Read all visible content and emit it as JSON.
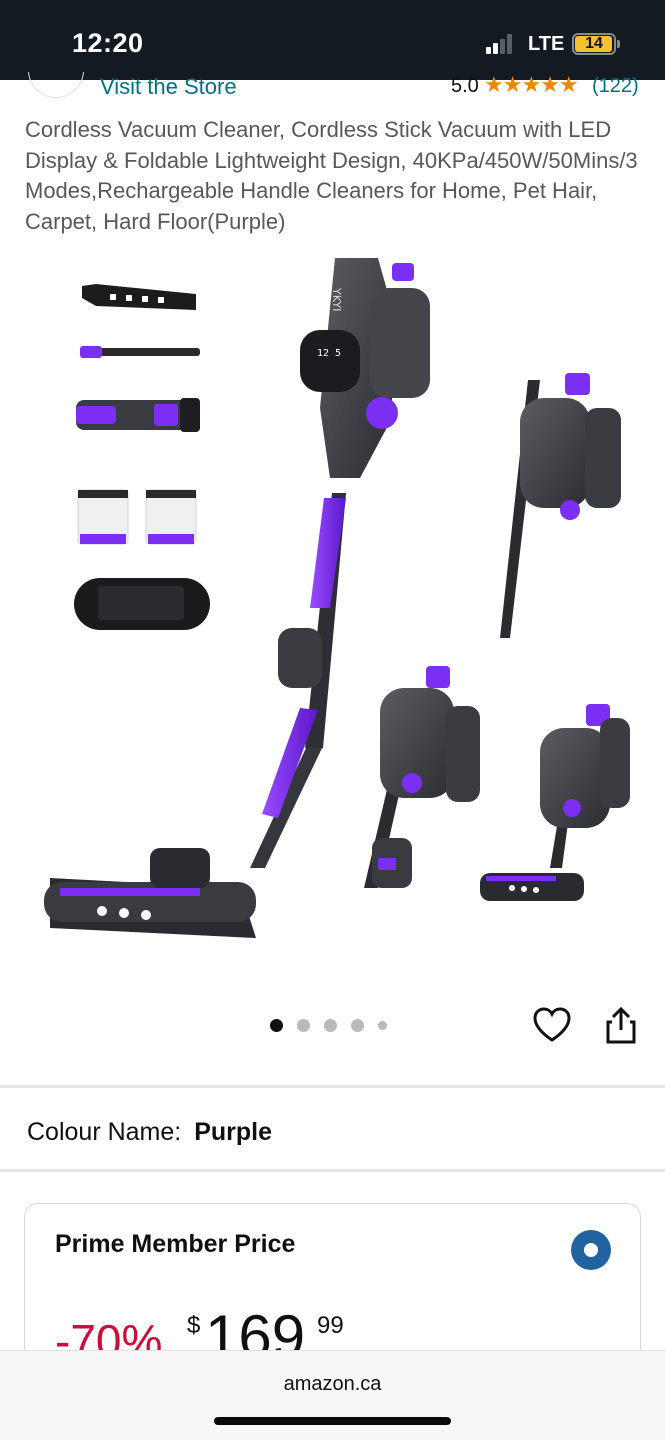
{
  "status_bar": {
    "time": "12:20",
    "network": "LTE",
    "battery": "14",
    "battery_level": 0.14
  },
  "store": {
    "link_text": "Visit the Store",
    "rating": "5.0",
    "stars": "★★★★★",
    "rating_count": "(122)"
  },
  "product": {
    "title": "Cordless Vacuum Cleaner, Cordless Stick Vacuum with LED Display & Foldable Lightweight Design, 40KPa/450W/50Mins/3 Modes,Rechargeable Handle Cleaners for Home, Pet Hair, Carpet, Hard Floor(Purple)",
    "image_brand": "YKYI",
    "image_count": 5,
    "active_image": 1
  },
  "colour": {
    "label": "Colour Name:",
    "value": "Purple"
  },
  "price_card": {
    "title": "Prime Member Price",
    "discount": "-70%",
    "currency": "$",
    "whole": "169",
    "fraction": "99"
  },
  "browser": {
    "url": "amazon.ca"
  },
  "colors": {
    "status_bar_bg": "#131a22",
    "link": "#007185",
    "star": "#f08804",
    "discount": "#cc0c39",
    "radio": "#2162a1",
    "product_accent": "#7b2ff2"
  }
}
